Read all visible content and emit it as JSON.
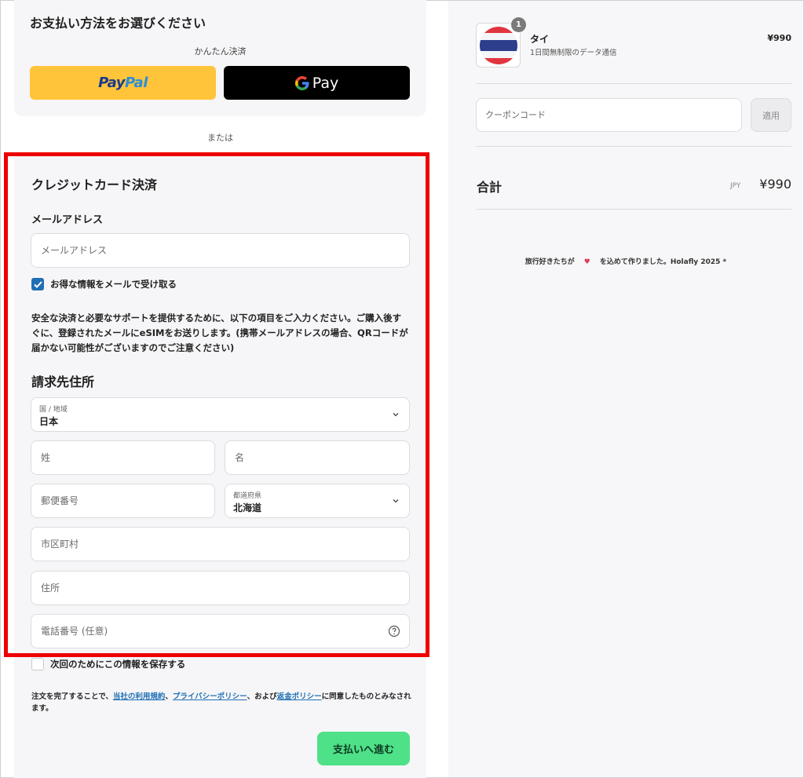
{
  "payment": {
    "title": "お支払い方法をお選びください",
    "express_label": "かんたん決済",
    "paypal_part1": "Pay",
    "paypal_part2": "Pal",
    "gpay_label": "Pay",
    "or_label": "または"
  },
  "credit_card": {
    "title": "クレジットカード決済",
    "email_heading": "メールアドレス",
    "email_placeholder": "メールアドレス",
    "newsletter_label": "お得な情報をメールで受け取る",
    "newsletter_checked": true,
    "notice": "安全な決済と必要なサポートを提供するために、以下の項目をご入力ください。ご購入後すぐに、登録されたメールにeSIMをお送りします。(携帯メールアドレスの場合、QRコードが届かない可能性がございますのでご注意ください)"
  },
  "billing": {
    "title": "請求先住所",
    "country_label": "国 / 地域",
    "country_value": "日本",
    "last_name_placeholder": "姓",
    "first_name_placeholder": "名",
    "postal_placeholder": "郵便番号",
    "prefecture_label": "都道府県",
    "prefecture_value": "北海道",
    "city_placeholder": "市区町村",
    "address_placeholder": "住所",
    "phone_placeholder": "電話番号 (任意)",
    "save_info_label": "次回のためにこの情報を保存する",
    "save_info_checked": false
  },
  "terms": {
    "prefix": "注文を完了することで、",
    "link_terms": "当社の利用規約",
    "sep1": "、",
    "link_privacy": "プライバシーポリシー",
    "sep2": "、および",
    "link_refund": "返金ポリシー",
    "suffix": "に同意したものとみなされます。"
  },
  "submit_label": "支払いへ進む",
  "cart": {
    "item_count": "1",
    "product_name": "タイ",
    "product_desc": "1日間無制限のデータ通信",
    "product_price": "¥990",
    "coupon_placeholder": "クーポンコード",
    "apply_label": "適用",
    "total_label": "合計",
    "total_currency": "JPY",
    "total_value": "¥990"
  },
  "footer": {
    "left": "旅行好きたちが",
    "right": "を込めて作りました。Holafly 2025 *",
    "heart": "♥"
  },
  "colors": {
    "paypal_bg": "#ffc43a",
    "submit_bg": "#4ee187",
    "checkbox_blue": "#1f6fb4",
    "highlight_red": "#ee0000"
  }
}
